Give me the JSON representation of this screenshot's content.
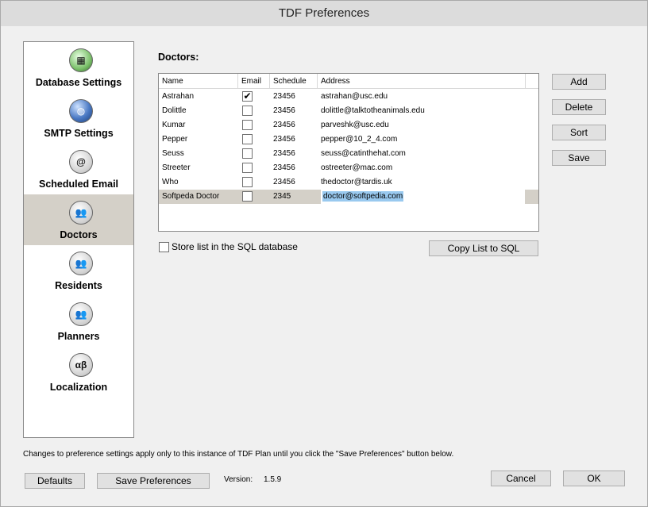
{
  "window": {
    "title": "TDF Preferences"
  },
  "sidebar": {
    "items": [
      {
        "label": "Database Settings",
        "icon": "database-icon",
        "glyph": "▦",
        "selected": false
      },
      {
        "label": "SMTP Settings",
        "icon": "globe-icon",
        "glyph": "◍",
        "selected": false
      },
      {
        "label": "Scheduled Email",
        "icon": "at-sign-icon",
        "glyph": "@",
        "selected": false
      },
      {
        "label": "Doctors",
        "icon": "people-icon",
        "glyph": "👥",
        "selected": true
      },
      {
        "label": "Residents",
        "icon": "people-icon",
        "glyph": "👥",
        "selected": false
      },
      {
        "label": "Planners",
        "icon": "people-icon",
        "glyph": "👥",
        "selected": false
      },
      {
        "label": "Localization",
        "icon": "alpha-beta-icon",
        "glyph": "αβ",
        "selected": false
      }
    ]
  },
  "doctors": {
    "title": "Doctors:",
    "columns": [
      "Name",
      "Email",
      "Schedule",
      "Address"
    ],
    "rows": [
      {
        "name": "Astrahan",
        "email": true,
        "schedule": "23456",
        "address": "astrahan@usc.edu"
      },
      {
        "name": "Dolittle",
        "email": false,
        "schedule": "23456",
        "address": "dolittle@talktotheanimals.edu"
      },
      {
        "name": "Kumar",
        "email": false,
        "schedule": "23456",
        "address": "parveshk@usc.edu"
      },
      {
        "name": "Pepper",
        "email": false,
        "schedule": "23456",
        "address": "pepper@10_2_4.com"
      },
      {
        "name": "Seuss",
        "email": false,
        "schedule": "23456",
        "address": "seuss@catinthehat.com"
      },
      {
        "name": "Streeter",
        "email": false,
        "schedule": "23456",
        "address": "ostreeter@mac.com"
      },
      {
        "name": "Who",
        "email": false,
        "schedule": "23456",
        "address": "thedoctor@tardis.uk"
      },
      {
        "name": "Softpeda Doctor",
        "email": false,
        "schedule": "2345",
        "address": "doctor@softpedia.com",
        "editing": true
      }
    ],
    "buttons": {
      "add": "Add",
      "delete": "Delete",
      "sort": "Sort",
      "save": "Save"
    },
    "store_checkbox_label": "Store list in the SQL database",
    "store_checked": false,
    "copy_button": "Copy List to SQL"
  },
  "footer": {
    "note": "Changes to preference settings apply only to this instance of TDF Plan until you click the \"Save Preferences\" button below.",
    "defaults_button": "Defaults",
    "save_prefs_button": "Save Preferences",
    "version_label": "Version:",
    "version_value": "1.5.9",
    "cancel_button": "Cancel",
    "ok_button": "OK"
  }
}
